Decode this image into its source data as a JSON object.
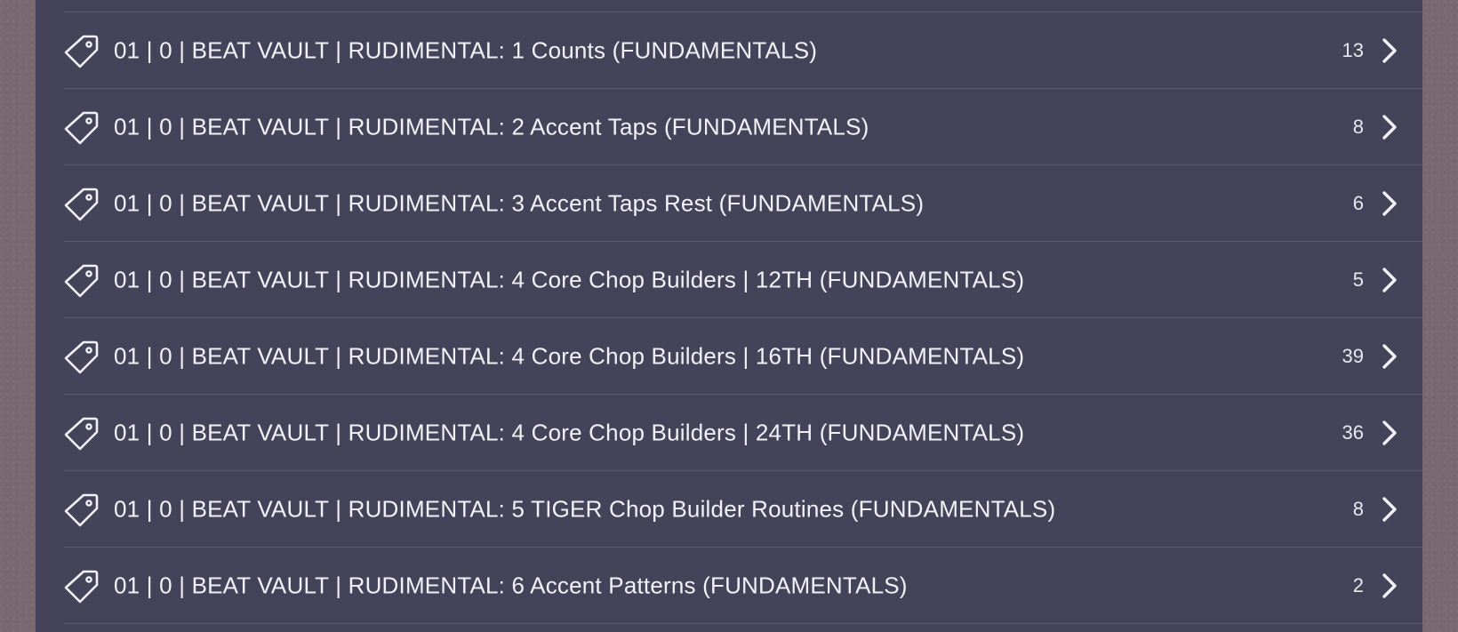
{
  "tags_list": {
    "items": [
      {
        "label": "01 | 0 | BEAT VAULT | RUDIMENTAL: 1 Counts (FUNDAMENTALS)",
        "count": "13",
        "icon": "tag-icon"
      },
      {
        "label": "01 | 0 | BEAT VAULT | RUDIMENTAL: 2 Accent Taps (FUNDAMENTALS)",
        "count": "8",
        "icon": "tag-icon"
      },
      {
        "label": "01 | 0 | BEAT VAULT | RUDIMENTAL: 3 Accent Taps Rest (FUNDAMENTALS)",
        "count": "6",
        "icon": "tag-icon"
      },
      {
        "label": "01 | 0 | BEAT VAULT | RUDIMENTAL: 4 Core Chop Builders | 12TH (FUNDAMENTALS)",
        "count": "5",
        "icon": "tag-icon"
      },
      {
        "label": "01 | 0 | BEAT VAULT | RUDIMENTAL: 4 Core Chop Builders | 16TH (FUNDAMENTALS)",
        "count": "39",
        "icon": "tag-icon"
      },
      {
        "label": "01 | 0 | BEAT VAULT | RUDIMENTAL: 4 Core Chop Builders | 24TH (FUNDAMENTALS)",
        "count": "36",
        "icon": "tag-icon"
      },
      {
        "label": "01 | 0 | BEAT VAULT | RUDIMENTAL: 5 TIGER Chop Builder Routines (FUNDAMENTALS)",
        "count": "8",
        "icon": "tag-icon"
      },
      {
        "label": "01 | 0 | BEAT VAULT | RUDIMENTAL: 6 Accent Patterns (FUNDAMENTALS)",
        "count": "2",
        "icon": "tag-icon"
      }
    ]
  },
  "colors": {
    "panel_background": "#45435a",
    "page_background": "#7a6870",
    "text": "#f2f1f5",
    "divider": "#5d5b70"
  }
}
